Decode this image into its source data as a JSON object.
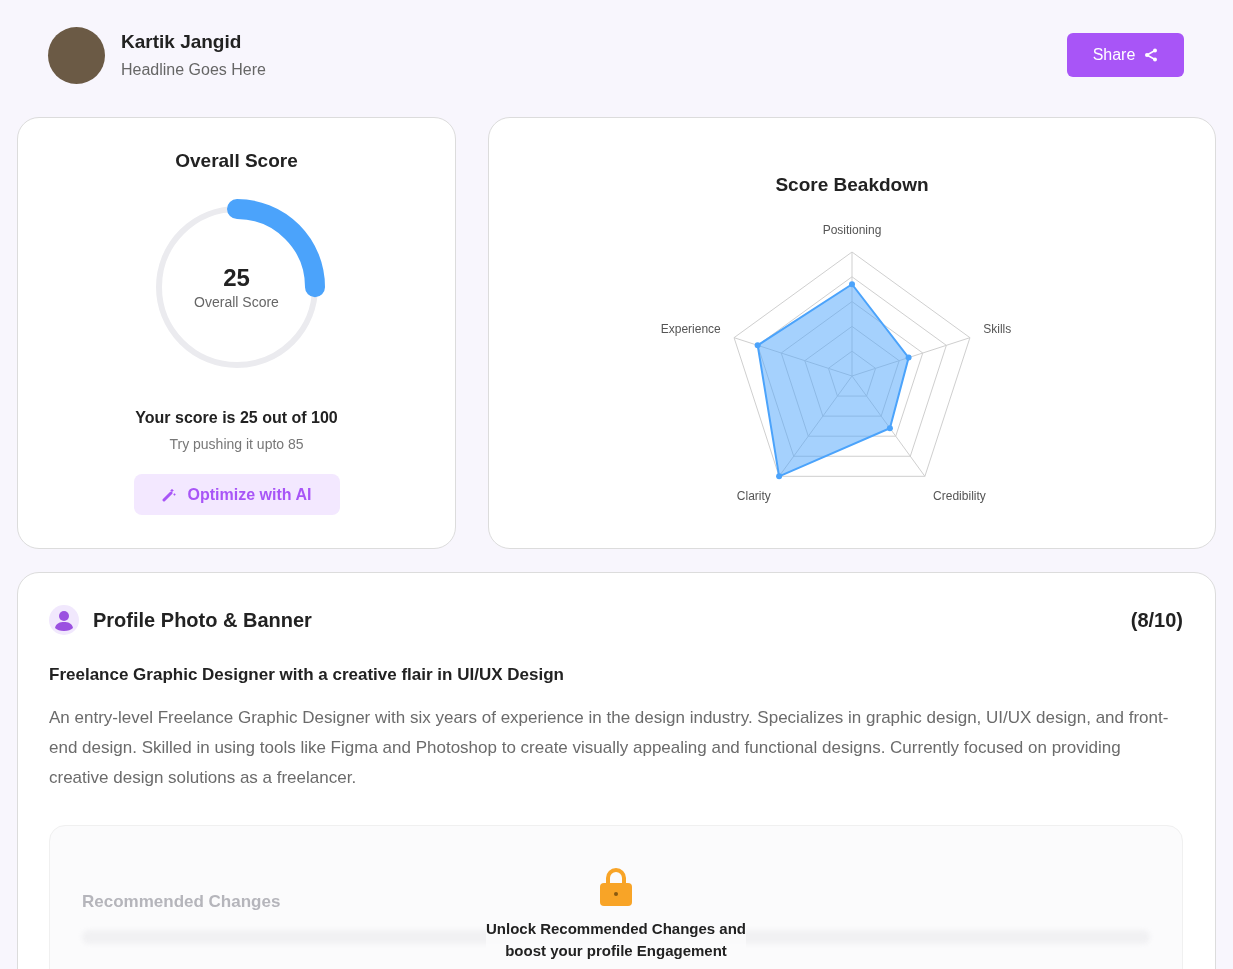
{
  "profile": {
    "name": "Kartik Jangid",
    "headline": "Headline Goes Here"
  },
  "share_button": {
    "label": "Share"
  },
  "overall_card": {
    "title": "Overall Score",
    "score": "25",
    "score_caption": "Overall Score",
    "level": 0.25,
    "summary": "Your score is 25 out of 100",
    "hint": "Try pushing it upto 85",
    "button": "Optimize with AI"
  },
  "breakdown_card": {
    "title": "Score Beakdown",
    "axes": [
      "Positioning",
      "Skills",
      "Credibility",
      "Clarity",
      "Experience"
    ]
  },
  "section": {
    "title": "Profile Photo & Banner",
    "score": "(8/10)",
    "subtitle": "Freelance Graphic Designer with a creative flair in UI/UX Design",
    "description": "An entry-level Freelance Graphic Designer with six years of experience in the design industry. Specializes in graphic design, UI/UX design, and front-end design. Skilled in using tools like Figma and Photoshop to create visually appealing and functional designs. Currently focused on providing creative design solutions as a freelancer.",
    "locked": {
      "heading": "Recommended Changes",
      "message_line_1": "Unlock Recommended Changes and",
      "message_line_2": "boost your profile Engagement"
    }
  }
}
